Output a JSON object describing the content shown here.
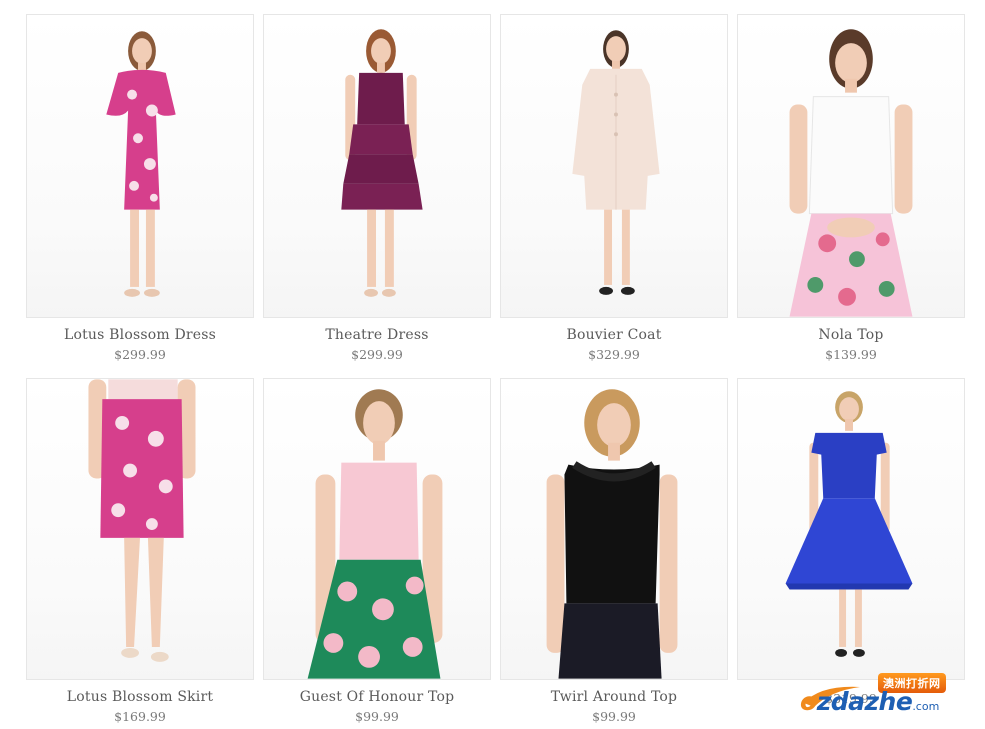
{
  "products": [
    {
      "name": "Lotus Blossom Dress",
      "price": "$299.99",
      "image_icon": "floral-dress-model-image"
    },
    {
      "name": "Theatre Dress",
      "price": "$299.99",
      "image_icon": "ruffled-dress-model-image"
    },
    {
      "name": "Bouvier Coat",
      "price": "$329.99",
      "image_icon": "coat-model-image"
    },
    {
      "name": "Nola Top",
      "price": "$139.99",
      "image_icon": "lace-top-model-image"
    },
    {
      "name": "Lotus Blossom Skirt",
      "price": "$169.99",
      "image_icon": "floral-skirt-model-image"
    },
    {
      "name": "Guest Of Honour Top",
      "price": "$99.99",
      "image_icon": "halter-top-model-image"
    },
    {
      "name": "Twirl Around Top",
      "price": "$99.99",
      "image_icon": "black-top-model-image"
    },
    {
      "name": "",
      "price": "$319.99",
      "image_icon": "lace-dress-model-image"
    }
  ],
  "watermark": {
    "chinese": "澳洲打折网",
    "logo_o": "o",
    "logo_rest": "zdazhe",
    "logo_tld": ".com"
  },
  "colors": {
    "text": "#5a5a5a",
    "price": "#7a7a7a",
    "border": "#e6e6e6",
    "watermark_blue": "#1e5fb3",
    "watermark_orange": "#f08a1c"
  }
}
